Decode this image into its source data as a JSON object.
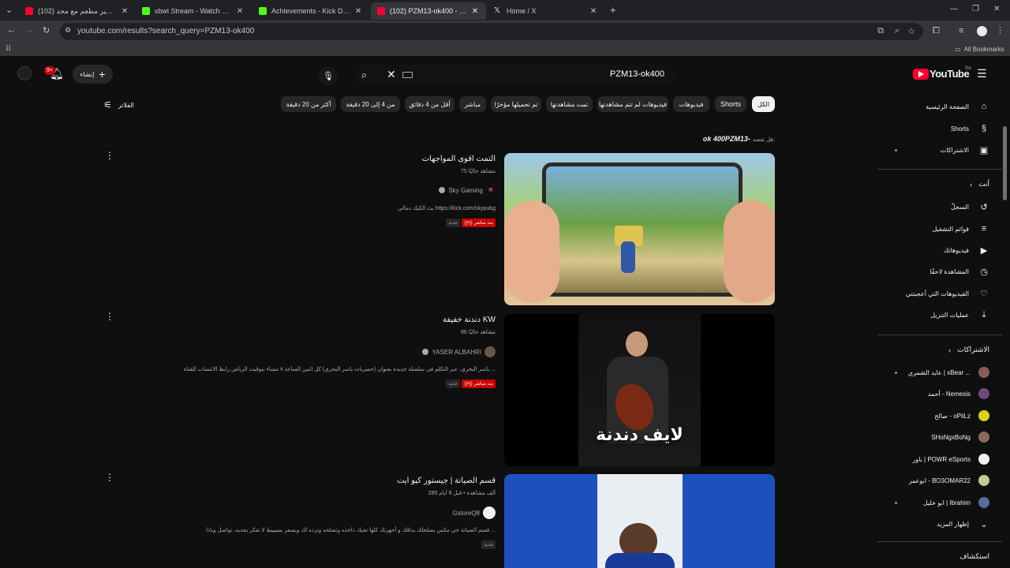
{
  "browser": {
    "tabs": [
      {
        "label": "(102) حرت كاشير مطعم مع محد...",
        "fav_color": "#ff0033",
        "active": false
      },
      {
        "label": "xbwi Stream - Watch Live on Ki...",
        "fav_color": "#53fc18",
        "active": false
      },
      {
        "label": "Achievements - Kick Dashboard",
        "fav_color": "#53fc18",
        "active": false
      },
      {
        "label": "(102) PZM13-ok400 - YouTube",
        "fav_color": "#ff0033",
        "active": true
      },
      {
        "label": "Home / X",
        "fav_color": "#e7e9ea",
        "active": false
      }
    ],
    "url": "youtube.com/results?search_query=PZM13-ok400",
    "all_bookmarks": "All Bookmarks"
  },
  "header": {
    "logo_text": "YouTube",
    "logo_country": "SA",
    "search_value": "PZM13-ok400",
    "create_label": "إنشاء",
    "notif_count": "9+"
  },
  "filters": {
    "label": "الفلاتر",
    "chips": [
      "الكل",
      "Shorts",
      "فيديوهات",
      "فيديوهات لم تتم مشاهدتها",
      "تمت مشاهدتها",
      "تم تحميلها مؤخرًا",
      "مباشر",
      "أقل من 4 دقائق",
      "من 4 إلى 20 دقيقة",
      "أكثر من 20 دقيقة"
    ]
  },
  "did_you_mean": {
    "label": "هل تقصد:",
    "query": "ok 400PZM13-"
  },
  "results": [
    {
      "title": "التمت اقوى المواجهات",
      "meta": "75 مشاهد حاليًا",
      "channel": "Sky Gaming",
      "desc": "بث الكيك دمالي https://kick.com/skypubg",
      "live_label": "بث مباشر",
      "new_label": "جديد"
    },
    {
      "title": "دندنة خفيفة KW",
      "meta": "86 مشاهد حاليًا",
      "channel": "YASER ALBAHRI",
      "desc": "ياسر البحري، عبر التكلم في سلسلة جديدة بعنوان (حصريات ياسر البحري) كل اثنين الساعة ٧ مساء بتوقيت الرياض رابط الانتساب للقناة ...",
      "live_label": "بث مباشر",
      "new_label": "جديد",
      "thumb_text": "لايف دندنة"
    },
    {
      "title": "قسم الصيانة | جيستور كيو ايت",
      "meta": "285 ألف مشاهدة • قبل 6 أيام",
      "channel": "GstoreQ8",
      "desc": "قسم الصيانة حي مكس يصلحلك بداقك و أجهزتك كلها تجيك ذاخذه وتصلحه وترده لك وبسعر بسيييط لا تفكر بجديد، تواصل وياذا ...",
      "new_label": "جديد"
    }
  ],
  "sidebar": {
    "main": [
      {
        "label": "الصفحة الرئيسية",
        "icon": "home-icon",
        "glyph": "⌂"
      },
      {
        "label": "Shorts",
        "icon": "shorts-icon",
        "glyph": "§"
      },
      {
        "label": "الاشتراكات",
        "icon": "subscriptions-icon",
        "glyph": "▣"
      }
    ],
    "you_header": "أنت",
    "you": [
      {
        "label": "السجلّ",
        "icon": "history-icon",
        "glyph": "↺"
      },
      {
        "label": "قوائم التشغيل",
        "icon": "playlists-icon",
        "glyph": "≡"
      },
      {
        "label": "فيديوهاتك",
        "icon": "your-videos-icon",
        "glyph": "▶"
      },
      {
        "label": "المشاهدة لاحقًا",
        "icon": "watch-later-icon",
        "glyph": "◷"
      },
      {
        "label": "الفيديوهات التي أعجبتني",
        "icon": "like-icon",
        "glyph": "👍"
      },
      {
        "label": "عمليات التنزيل",
        "icon": "download-icon",
        "glyph": "⤓"
      }
    ],
    "subs_header": "الاشتراكات",
    "subscriptions": [
      {
        "label": "عايد الشمري | xBear ...",
        "color": "#8b5a5a",
        "dot": true
      },
      {
        "label": "أحمد - Nemesis",
        "color": "#6a4a7a",
        "dot": false
      },
      {
        "label": "صالح - oPiiLz",
        "color": "#d9d21a",
        "dot": false
      },
      {
        "label": "SHoNgxBoNg",
        "color": "#8a6a5a",
        "dot": false
      },
      {
        "label": "باور | POWR eSports",
        "color": "#f0f0f0",
        "dot": false
      },
      {
        "label": "ابوعمر - BO3OMAR22",
        "color": "#c8c890",
        "dot": false
      },
      {
        "label": "ابو خليل | Ibrahim",
        "color": "#5a6a9a",
        "dot": true
      }
    ],
    "show_more": "إظهار المزيد",
    "explore": "استكشاف"
  }
}
